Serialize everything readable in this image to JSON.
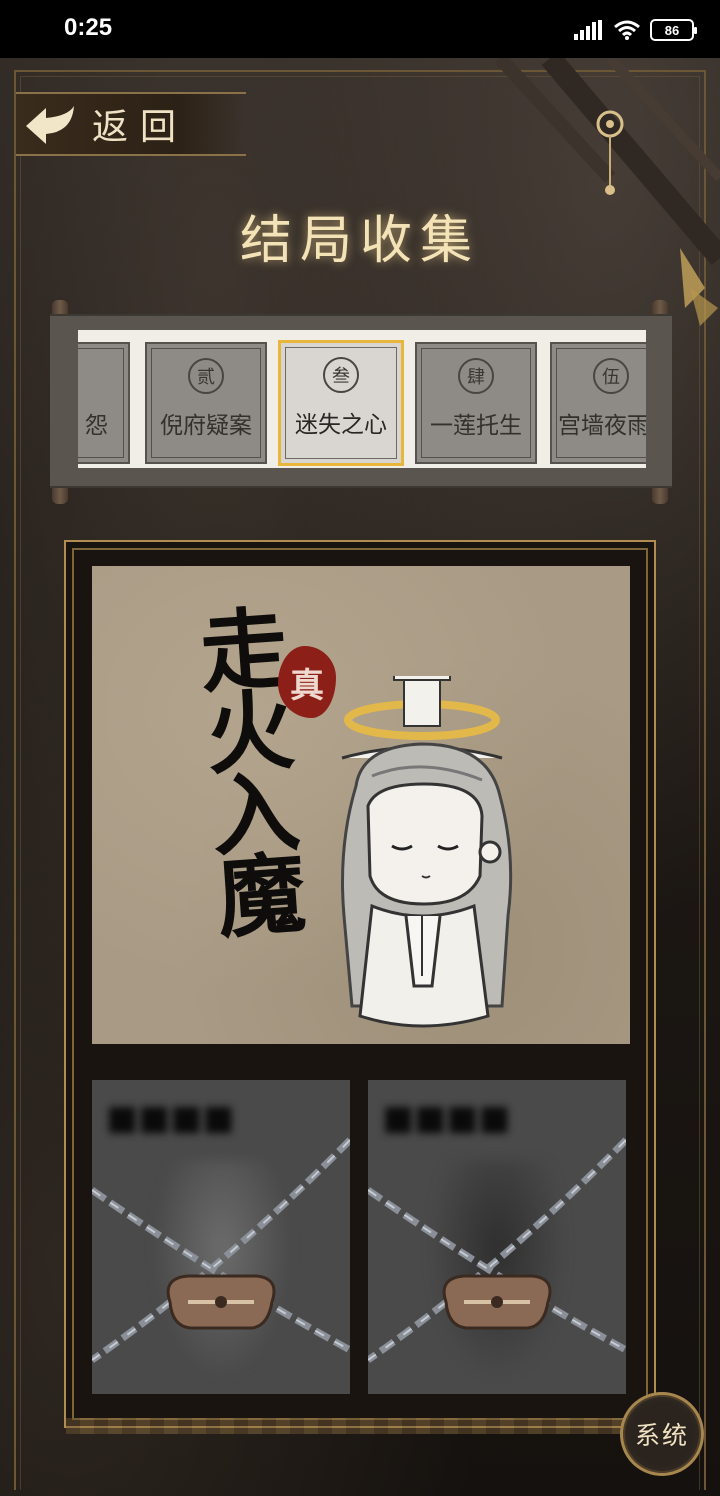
{
  "status_bar": {
    "time": "0:25",
    "battery": "86",
    "icons": [
      "signal-icon",
      "wifi-icon",
      "battery-icon"
    ]
  },
  "nav": {
    "back_label": "返回"
  },
  "page": {
    "title": "结局收集"
  },
  "chapters": [
    {
      "num": "",
      "name": "怨",
      "selected": false
    },
    {
      "num": "贰",
      "name": "倪府疑案",
      "selected": false
    },
    {
      "num": "叁",
      "name": "迷失之心",
      "selected": true
    },
    {
      "num": "肆",
      "name": "一莲托生",
      "selected": false
    },
    {
      "num": "伍",
      "name": "宫墙夜雨",
      "selected": false
    }
  ],
  "endings": {
    "unlocked": {
      "title": "走火入魔",
      "seal": "真"
    },
    "locked": [
      {
        "state": "locked"
      },
      {
        "state": "locked"
      }
    ]
  },
  "system_button": {
    "label": "系统"
  },
  "colors": {
    "accent_gold": "#e8b63a",
    "frame_gold": "#b28d52",
    "seal_red": "#8c1f17",
    "title_cream": "#f3e3b6"
  }
}
